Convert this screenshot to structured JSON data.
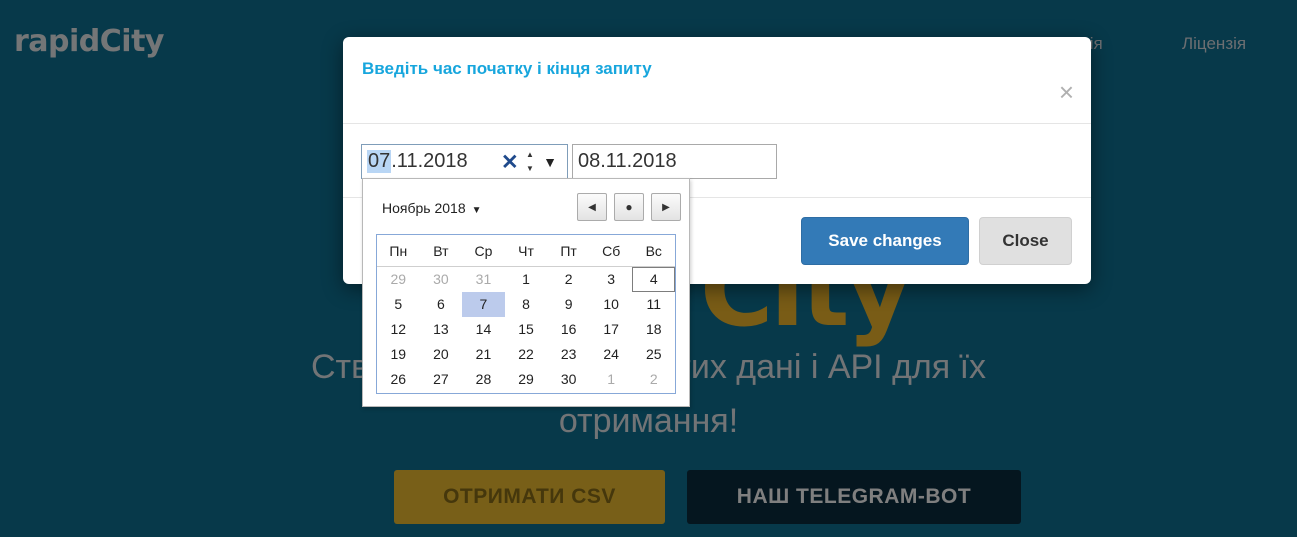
{
  "page": {
    "brand": "rapidCity",
    "nav": [
      "ція",
      "Ліцензія"
    ],
    "hero_big": "City",
    "hero_sub_line1": "Ств                 ри відкритих дані і API для їх",
    "hero_sub_line2": "отримання!",
    "buttons": {
      "csv": "ОТРИМАТИ CSV",
      "bot": "НАШ TELEGRAM-BOT"
    }
  },
  "modal": {
    "title": "Введіть час початку і кінця запиту",
    "close_icon": "×",
    "start_date": {
      "day": "07",
      "rest": ".11.2018"
    },
    "end_date": "08.11.2018",
    "save_label": "Save changes",
    "close_label": "Close"
  },
  "calendar": {
    "month_label": "Ноябрь 2018",
    "weekdays": [
      "Пн",
      "Вт",
      "Ср",
      "Чт",
      "Пт",
      "Сб",
      "Вс"
    ],
    "weeks": [
      [
        [
          "29",
          true
        ],
        [
          "30",
          true
        ],
        [
          "31",
          true
        ],
        [
          "1",
          false
        ],
        [
          "2",
          false
        ],
        [
          "3",
          false
        ],
        [
          "4",
          false
        ]
      ],
      [
        [
          "5",
          false
        ],
        [
          "6",
          false
        ],
        [
          "7",
          false
        ],
        [
          "8",
          false
        ],
        [
          "9",
          false
        ],
        [
          "10",
          false
        ],
        [
          "11",
          false
        ]
      ],
      [
        [
          "12",
          false
        ],
        [
          "13",
          false
        ],
        [
          "14",
          false
        ],
        [
          "15",
          false
        ],
        [
          "16",
          false
        ],
        [
          "17",
          false
        ],
        [
          "18",
          false
        ]
      ],
      [
        [
          "19",
          false
        ],
        [
          "20",
          false
        ],
        [
          "21",
          false
        ],
        [
          "22",
          false
        ],
        [
          "23",
          false
        ],
        [
          "24",
          false
        ],
        [
          "25",
          false
        ]
      ],
      [
        [
          "26",
          false
        ],
        [
          "27",
          false
        ],
        [
          "28",
          false
        ],
        [
          "29",
          false
        ],
        [
          "30",
          false
        ],
        [
          "1",
          true
        ],
        [
          "2",
          true
        ]
      ]
    ],
    "selected_day": "7",
    "today_day": "4"
  },
  "colors": {
    "accent": "#17a6dd",
    "primary": "#337ab7",
    "selected": "#bccbec"
  }
}
